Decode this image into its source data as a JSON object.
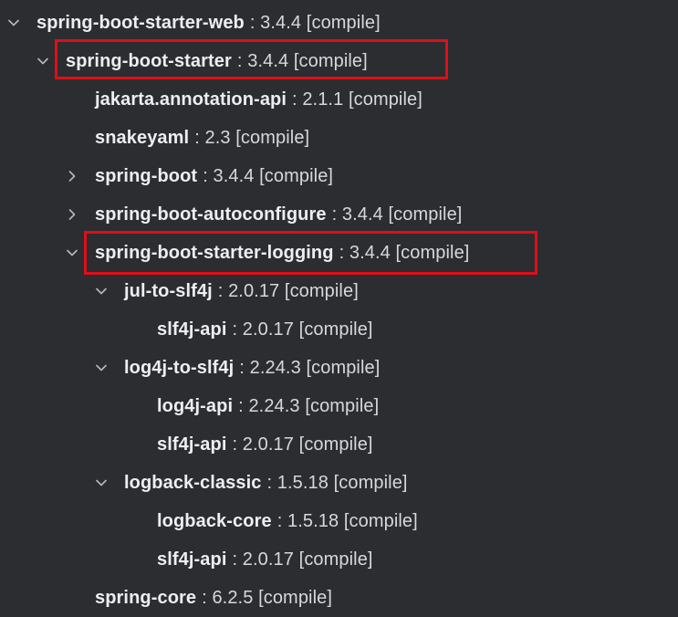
{
  "tree": {
    "rows": [
      {
        "name": "spring-boot-starter-web",
        "meta": ": 3.4.4 [compile]",
        "arrow": "chevron-down-icon"
      },
      {
        "name": "spring-boot-starter",
        "meta": ": 3.4.4 [compile]",
        "arrow": "chevron-down-icon"
      },
      {
        "name": "jakarta.annotation-api",
        "meta": ": 2.1.1 [compile]",
        "arrow": ""
      },
      {
        "name": "snakeyaml",
        "meta": ": 2.3 [compile]",
        "arrow": ""
      },
      {
        "name": "spring-boot",
        "meta": ": 3.4.4 [compile]",
        "arrow": "chevron-right-icon"
      },
      {
        "name": "spring-boot-autoconfigure",
        "meta": ": 3.4.4 [compile]",
        "arrow": "chevron-right-icon"
      },
      {
        "name": "spring-boot-starter-logging",
        "meta": ": 3.4.4 [compile]",
        "arrow": "chevron-down-icon"
      },
      {
        "name": "jul-to-slf4j",
        "meta": ": 2.0.17 [compile]",
        "arrow": "chevron-down-icon"
      },
      {
        "name": "slf4j-api",
        "meta": ": 2.0.17 [compile]",
        "arrow": ""
      },
      {
        "name": "log4j-to-slf4j",
        "meta": ": 2.24.3 [compile]",
        "arrow": "chevron-down-icon"
      },
      {
        "name": "log4j-api",
        "meta": ": 2.24.3 [compile]",
        "arrow": ""
      },
      {
        "name": "slf4j-api",
        "meta": ": 2.0.17 [compile]",
        "arrow": ""
      },
      {
        "name": "logback-classic",
        "meta": ": 1.5.18 [compile]",
        "arrow": "chevron-down-icon"
      },
      {
        "name": "logback-core",
        "meta": ": 1.5.18 [compile]",
        "arrow": ""
      },
      {
        "name": "slf4j-api",
        "meta": ": 2.0.17 [compile]",
        "arrow": ""
      },
      {
        "name": "spring-core",
        "meta": ": 6.2.5 [compile]",
        "arrow": ""
      }
    ]
  },
  "colors": {
    "background": "#2b2d30",
    "highlight": "#e00d19"
  }
}
